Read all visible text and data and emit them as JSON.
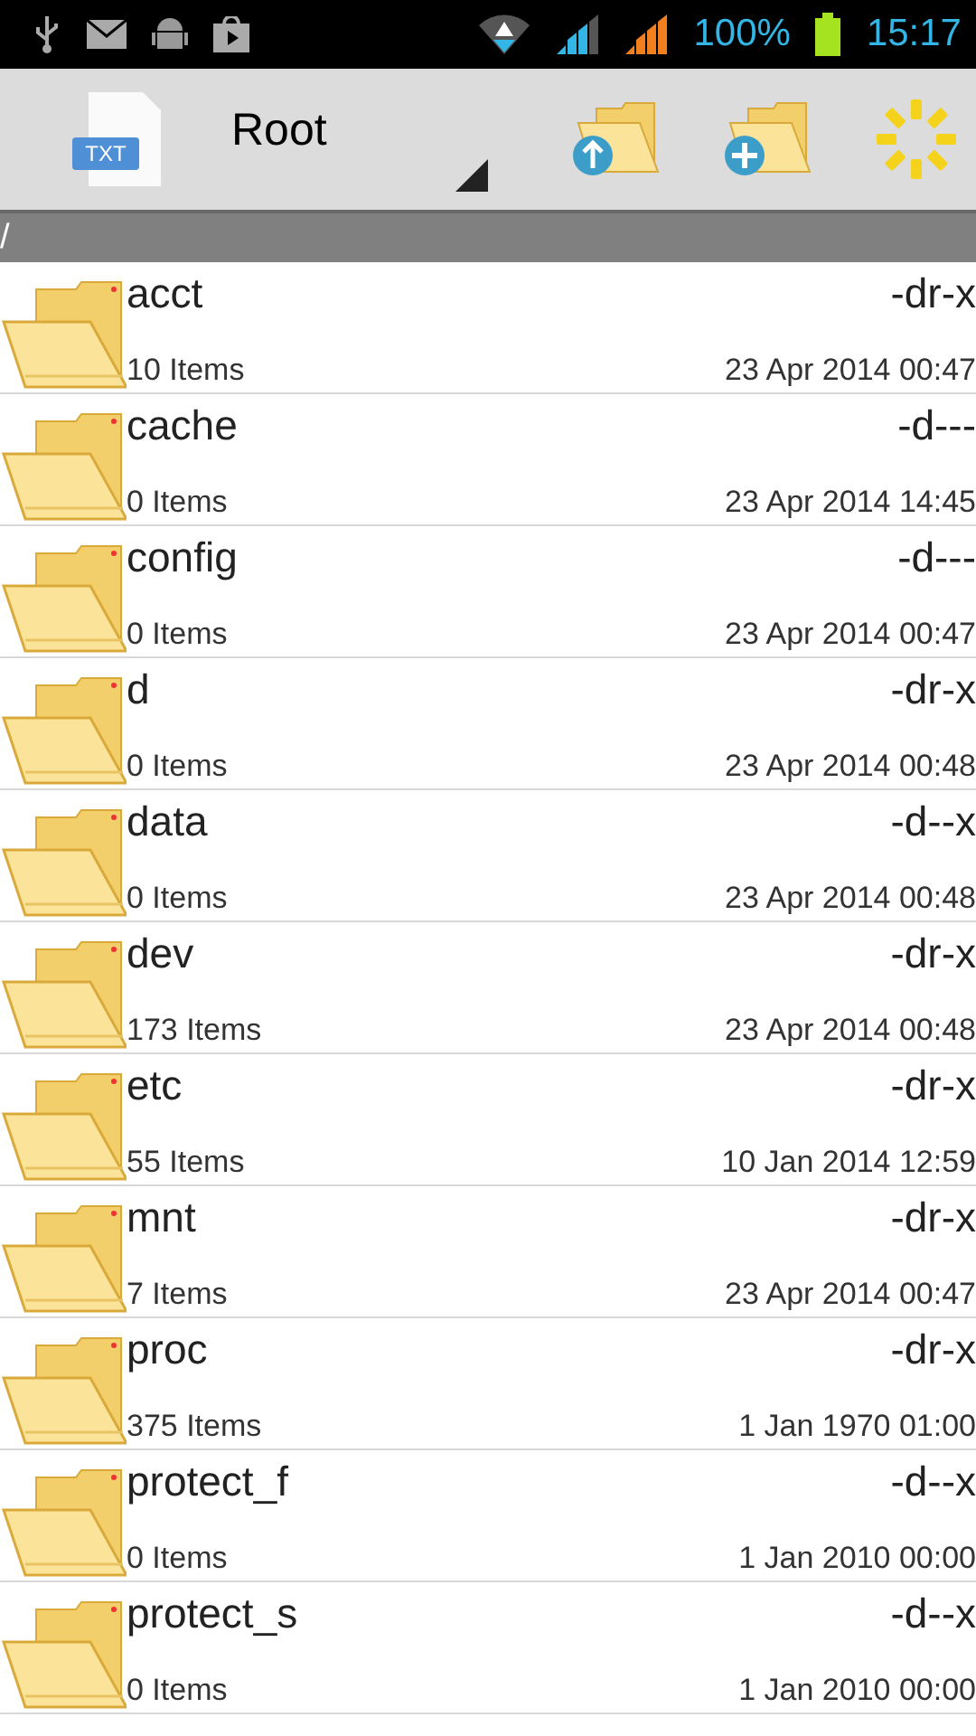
{
  "status_bar": {
    "battery": "100%",
    "time": "15:17"
  },
  "toolbar": {
    "title": "Root",
    "file_badge": "TXT"
  },
  "path": "/",
  "files": [
    {
      "name": "acct",
      "perms": "-dr-x",
      "count": "10 Items",
      "date": "23 Apr 2014 00:47"
    },
    {
      "name": "cache",
      "perms": "-d---",
      "count": "0 Items",
      "date": "23 Apr 2014 14:45"
    },
    {
      "name": "config",
      "perms": "-d---",
      "count": "0 Items",
      "date": "23 Apr 2014 00:47"
    },
    {
      "name": "d",
      "perms": "-dr-x",
      "count": "0 Items",
      "date": "23 Apr 2014 00:48"
    },
    {
      "name": "data",
      "perms": "-d--x",
      "count": "0 Items",
      "date": "23 Apr 2014 00:48"
    },
    {
      "name": "dev",
      "perms": "-dr-x",
      "count": "173 Items",
      "date": "23 Apr 2014 00:48"
    },
    {
      "name": "etc",
      "perms": "-dr-x",
      "count": "55 Items",
      "date": "10 Jan 2014 12:59"
    },
    {
      "name": "mnt",
      "perms": "-dr-x",
      "count": "7 Items",
      "date": "23 Apr 2014 00:47"
    },
    {
      "name": "proc",
      "perms": "-dr-x",
      "count": "375 Items",
      "date": "1 Jan 1970 01:00"
    },
    {
      "name": "protect_f",
      "perms": "-d--x",
      "count": "0 Items",
      "date": "1 Jan 2010 00:00"
    },
    {
      "name": "protect_s",
      "perms": "-d--x",
      "count": "0 Items",
      "date": "1 Jan 2010 00:00"
    }
  ]
}
